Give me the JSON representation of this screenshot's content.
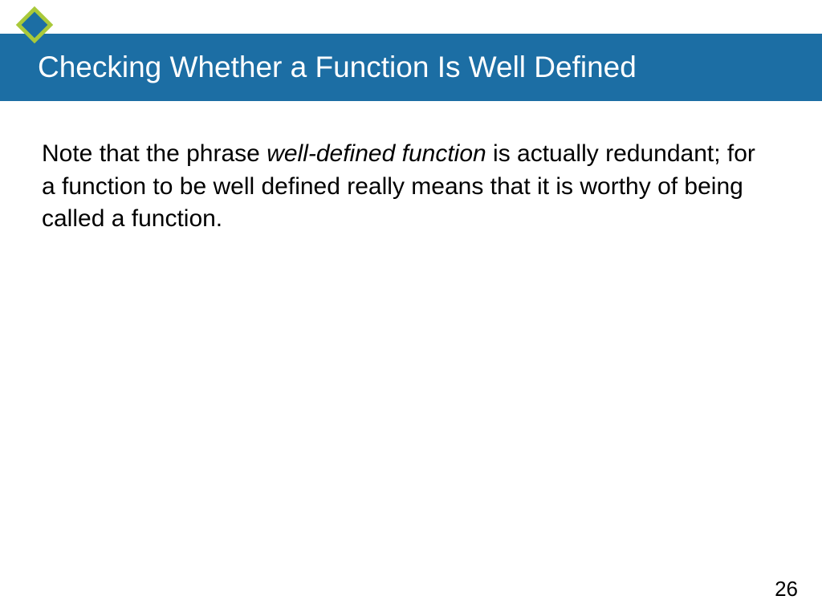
{
  "header": {
    "title": "Checking Whether a Function Is Well Defined"
  },
  "content": {
    "para_part1": "Note that the phrase ",
    "para_italic": "well-defined function",
    "para_part2": " is actually redundant; for a function to be well defined really means that it is worthy of being called a function."
  },
  "footer": {
    "page_number": "26"
  },
  "colors": {
    "title_bar_bg": "#1c6ea4",
    "diamond_outer": "#a9c93a",
    "diamond_inner": "#1c6ea4"
  }
}
